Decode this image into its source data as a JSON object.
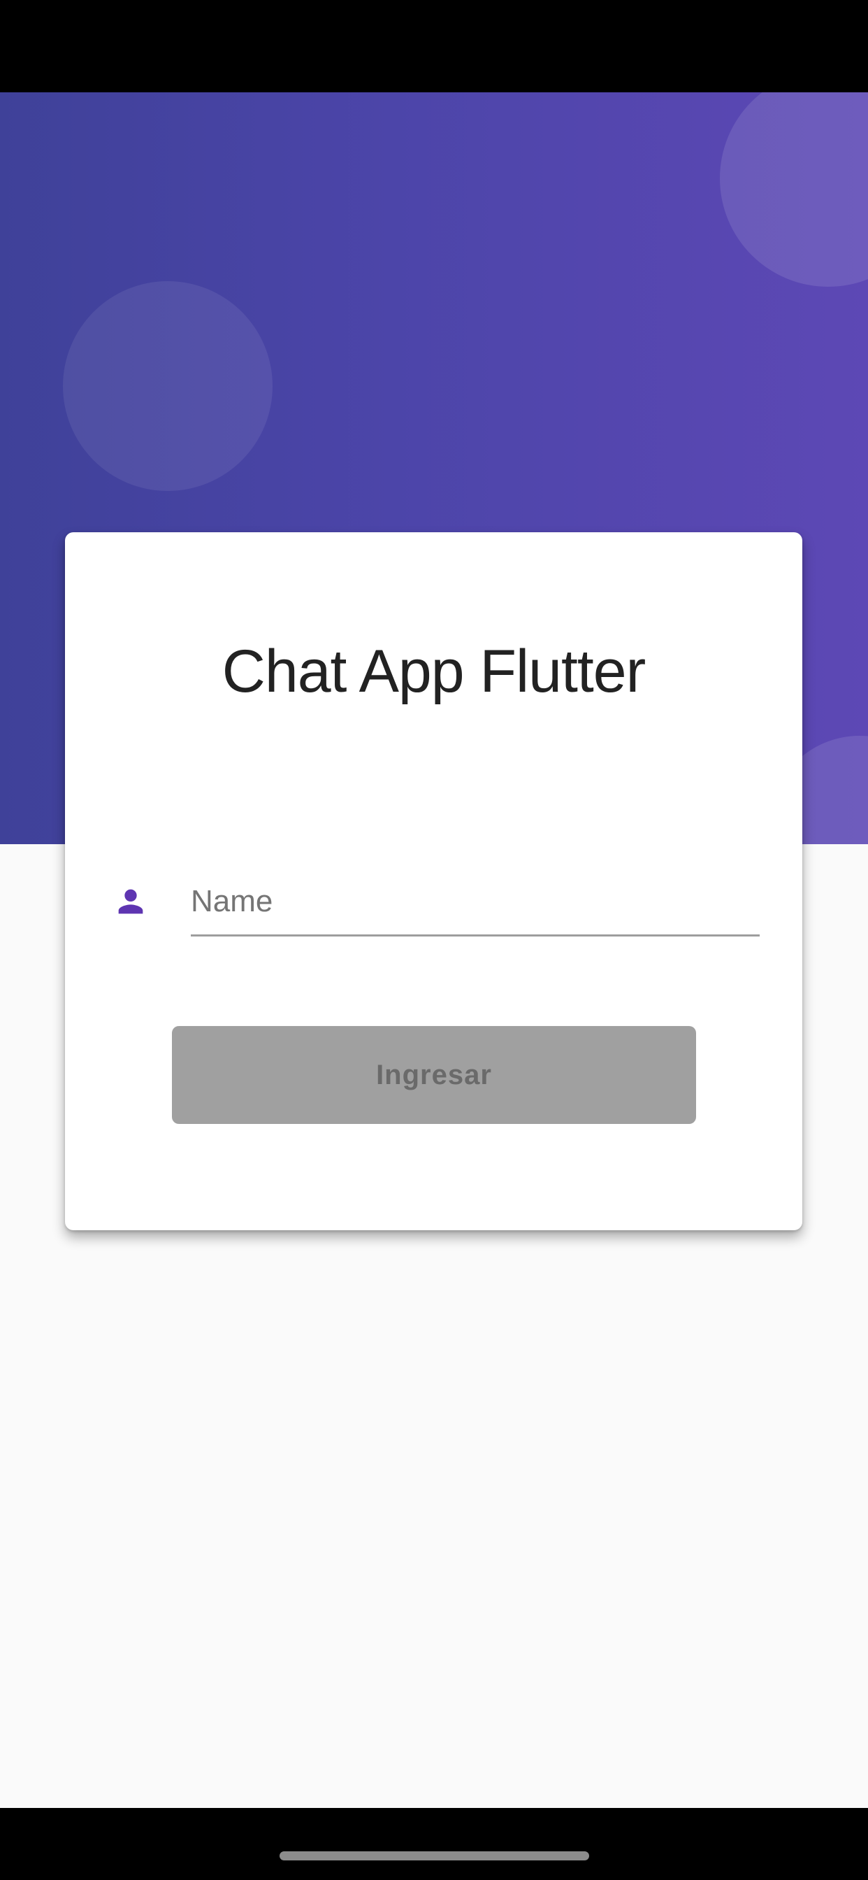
{
  "app": {
    "title": "Chat App Flutter"
  },
  "login_form": {
    "name_placeholder": "Name",
    "name_value": "",
    "name_icon": "person-icon",
    "submit_label": "Ingresar"
  },
  "colors": {
    "header_gradient_start": "#3f4199",
    "header_gradient_end": "#5d48b5",
    "icon_accent": "#5e35b1",
    "button_disabled": "#a0a0a0",
    "page_background": "#fafafa"
  }
}
